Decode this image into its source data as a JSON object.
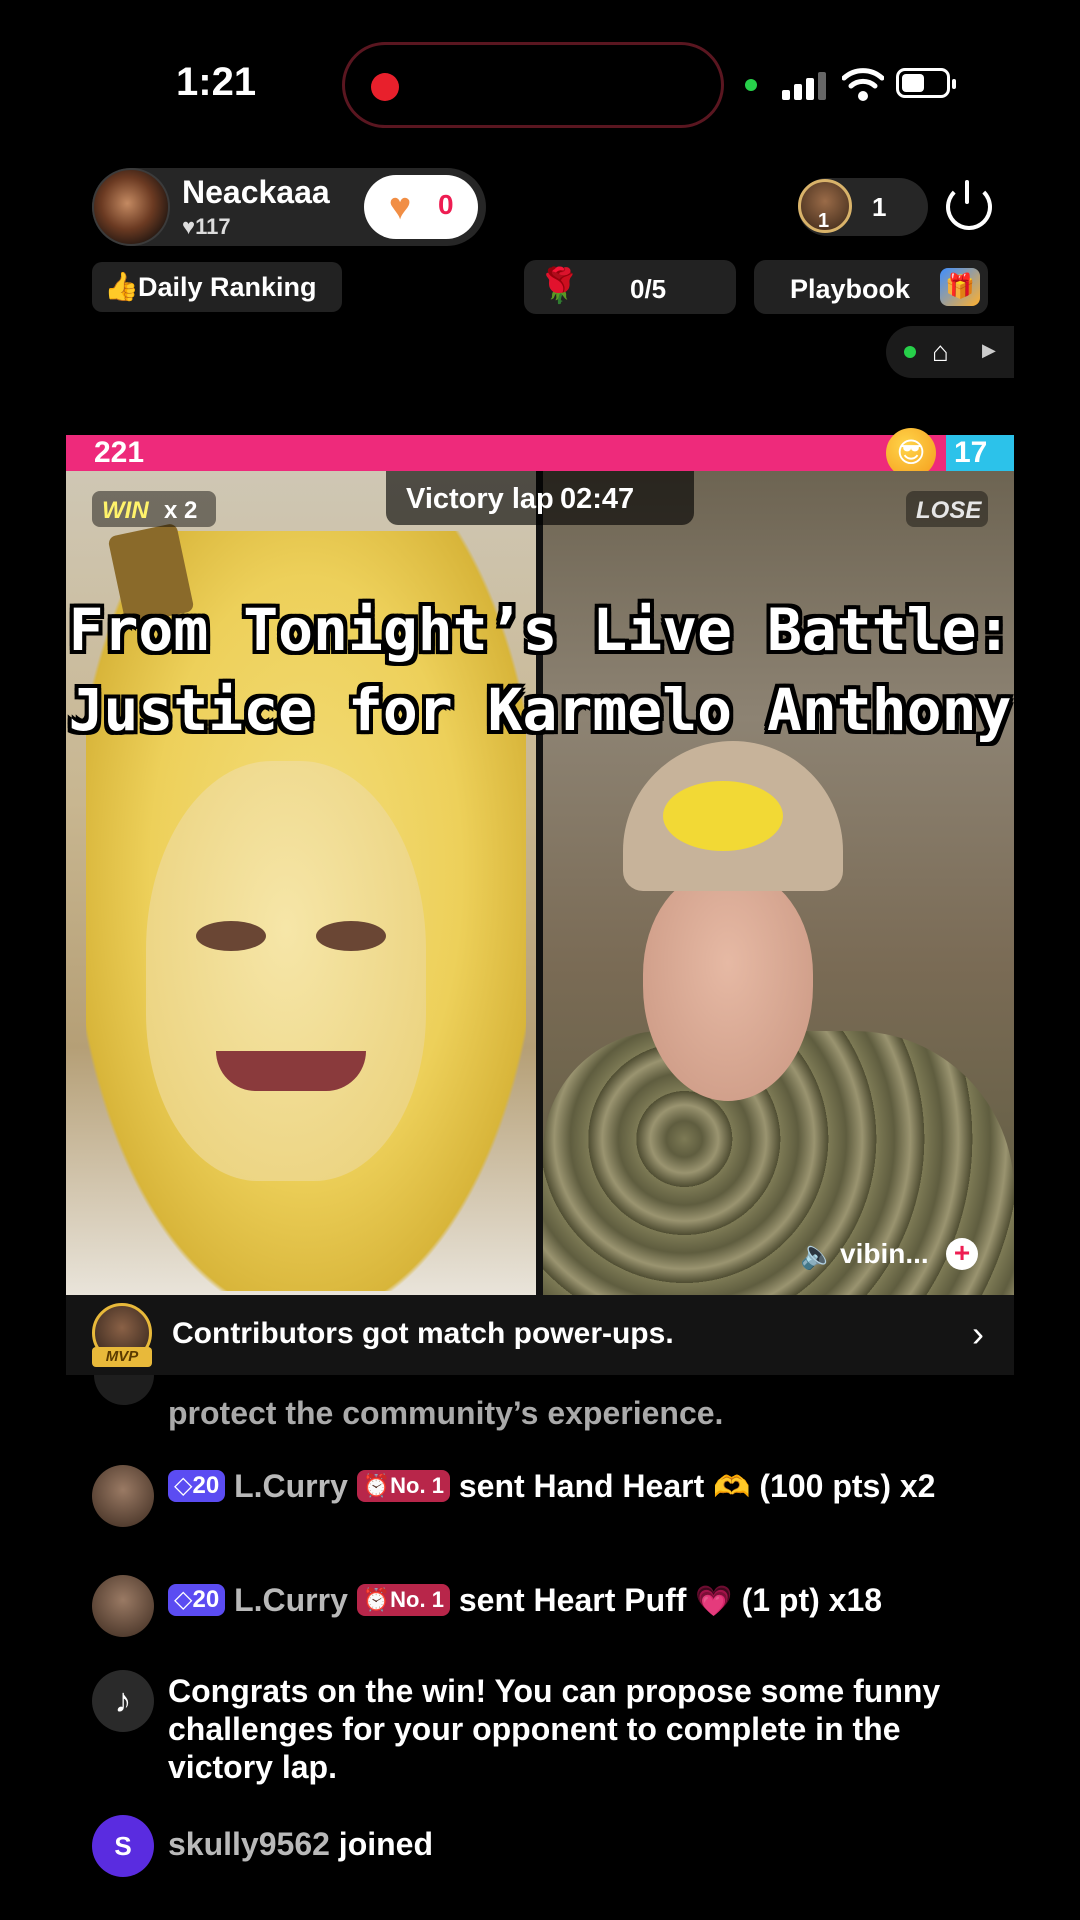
{
  "status_bar": {
    "time": "1:21"
  },
  "host": {
    "name": "Neackaaa",
    "likes": "♥117",
    "follow_count": "0"
  },
  "viewers": {
    "rank_badge": "1",
    "count": "1"
  },
  "toolbar": {
    "ranking_label": "Daily Ranking",
    "rose_count": "0/5",
    "playbook_label": "Playbook"
  },
  "battle": {
    "left_score": "221",
    "right_score": "17",
    "left_score_value": 221,
    "right_score_value": 17,
    "win_label": "WIN",
    "win_multiplier": "x 2",
    "lose_label": "LOSE",
    "victory_label": "Victory lap",
    "victory_timer": "02:47",
    "overlay_line1": "From Tonight’s Live Battle:",
    "overlay_line2": "Justice for Karmelo Anthony",
    "sound_label": "vibin...",
    "contrib_text": "Contributors got match power-ups.",
    "mvp_label": "MVP"
  },
  "chat": {
    "faded_line": "protect the community’s experience.",
    "messages": [
      {
        "level": "20",
        "user": "L.Curry",
        "rank": "No. 1",
        "text": "sent Hand Heart",
        "gift": "🫶",
        "suffix": "(100 pts) x2"
      },
      {
        "level": "20",
        "user": "L.Curry",
        "rank": "No. 1",
        "text": "sent Heart Puff",
        "gift": "💗",
        "suffix": "(1 pt) x18"
      },
      {
        "text": "Congrats on the win! You can propose some funny challenges for your opponent to complete in the victory lap."
      },
      {
        "avatar_letter": "S",
        "user": "skully9562",
        "text": "joined"
      }
    ]
  },
  "colors": {
    "accent_pink": "#ee2a7b",
    "accent_blue": "#2cc2ea",
    "tiktok_red": "#ee1d52"
  }
}
